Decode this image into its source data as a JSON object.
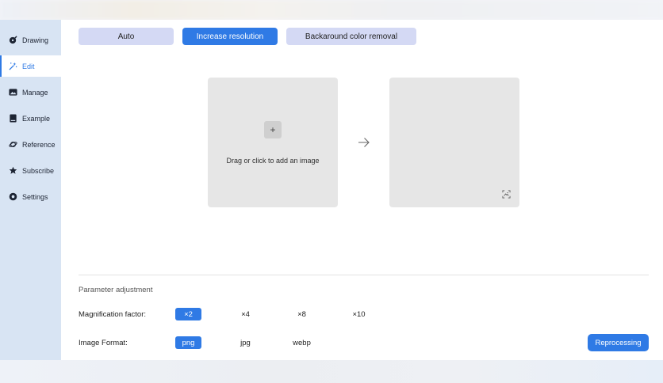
{
  "sidebar": {
    "items": [
      {
        "label": "Drawing",
        "icon": "drawing-icon",
        "active": false
      },
      {
        "label": "Edit",
        "icon": "magic-wand-icon",
        "active": true
      },
      {
        "label": "Manage",
        "icon": "image-icon",
        "active": false
      },
      {
        "label": "Example",
        "icon": "book-icon",
        "active": false
      },
      {
        "label": "Reference",
        "icon": "orbit-icon",
        "active": false
      },
      {
        "label": "Subscribe",
        "icon": "star-icon",
        "active": false
      },
      {
        "label": "Settings",
        "icon": "gear-icon",
        "active": false
      }
    ]
  },
  "tabs": {
    "auto": "Auto",
    "increase_resolution": "Increase resolution",
    "background_removal": "Backaround color removal"
  },
  "upload": {
    "plus": "+",
    "prompt": "Drag or click to add an image"
  },
  "params": {
    "title": "Parameter adjustment",
    "magnification": {
      "label": "Magnification factor:",
      "options": [
        "×2",
        "×4",
        "×8",
        "×10"
      ],
      "selected": "×2"
    },
    "format": {
      "label": "Image Format:",
      "options": [
        "png",
        "jpg",
        "webp"
      ],
      "selected": "png"
    }
  },
  "actions": {
    "reprocess": "Reprocessing"
  },
  "colors": {
    "accent": "#2f7ae5",
    "sidebar_bg": "#d8e4f3",
    "tab_inactive": "#d4d9f4",
    "box_bg": "#e6e6e6"
  }
}
